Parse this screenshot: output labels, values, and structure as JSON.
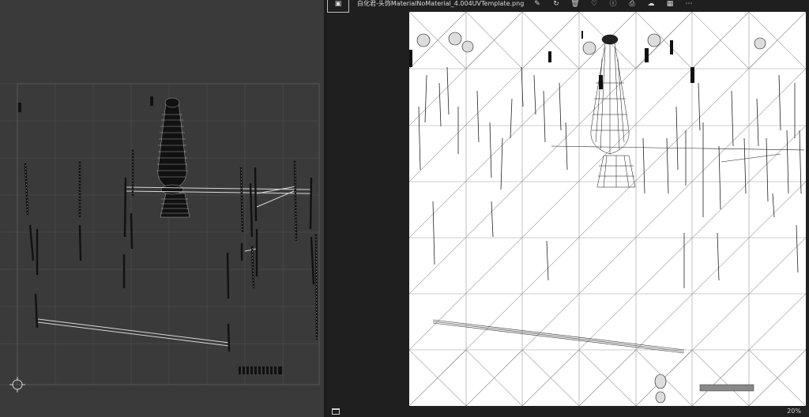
{
  "viewer": {
    "file_title": "白化君-头饰MaterialNoMaterial_4.004UVTemplate.png",
    "app_icon": "photos-app-icon",
    "toolbar": [
      {
        "name": "edit-icon",
        "glyph": "✎"
      },
      {
        "name": "rotate-icon",
        "glyph": "↻"
      },
      {
        "name": "delete-icon",
        "glyph": "🗑"
      },
      {
        "name": "favorite-icon",
        "glyph": "♡"
      },
      {
        "name": "info-icon",
        "glyph": "ⓘ"
      },
      {
        "name": "print-icon",
        "glyph": "⎙"
      },
      {
        "name": "cloud-icon",
        "glyph": "☁"
      },
      {
        "name": "gallery-icon",
        "glyph": "▦"
      },
      {
        "name": "more-icon",
        "glyph": "⋯"
      }
    ],
    "zoom_level": "20%"
  },
  "uv_editor": {
    "cursor_icon": "2d-cursor-icon"
  },
  "colors": {
    "editor_bg": "#3a3a3a",
    "viewer_bg": "#1f1f1f",
    "grid": "#4a4a4a",
    "uv_wire": "#111111",
    "uv_edge": "#cfcfcf"
  }
}
